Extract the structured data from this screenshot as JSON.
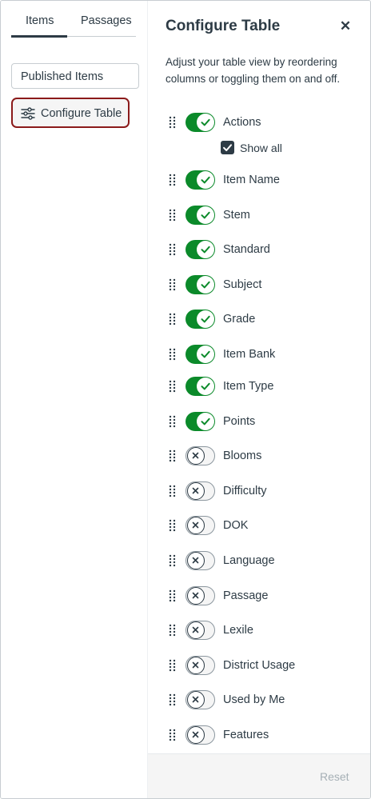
{
  "tabs": [
    {
      "label": "Items",
      "active": true
    },
    {
      "label": "Passages",
      "active": false
    }
  ],
  "filter": {
    "selected": "Published Items"
  },
  "configure_button": {
    "label": "Configure Table",
    "icon": "sliders-icon"
  },
  "panel": {
    "title": "Configure Table",
    "close_icon": "close-icon",
    "description": "Adjust your table view by reordering columns or toggling them on and off.",
    "show_all": {
      "label": "Show all",
      "checked": true
    },
    "columns": [
      {
        "label": "Actions",
        "enabled": true
      },
      {
        "label": "Item Name",
        "enabled": true
      },
      {
        "label": "Stem",
        "enabled": true
      },
      {
        "label": "Standard",
        "enabled": true
      },
      {
        "label": "Subject",
        "enabled": true
      },
      {
        "label": "Grade",
        "enabled": true
      },
      {
        "label": "Item Bank",
        "enabled": true
      },
      {
        "label": "Item Type",
        "enabled": true
      },
      {
        "label": "Points",
        "enabled": true
      },
      {
        "label": "Blooms",
        "enabled": false
      },
      {
        "label": "Difficulty",
        "enabled": false
      },
      {
        "label": "DOK",
        "enabled": false
      },
      {
        "label": "Language",
        "enabled": false
      },
      {
        "label": "Passage",
        "enabled": false
      },
      {
        "label": "Lexile",
        "enabled": false
      },
      {
        "label": "District Usage",
        "enabled": false
      },
      {
        "label": "Used by Me",
        "enabled": false
      },
      {
        "label": "Features",
        "enabled": false
      }
    ],
    "reset_label": "Reset"
  },
  "colors": {
    "toggle_on": "#0b8a2a",
    "text": "#2d3b45",
    "highlight_border": "#8b1a1a"
  }
}
